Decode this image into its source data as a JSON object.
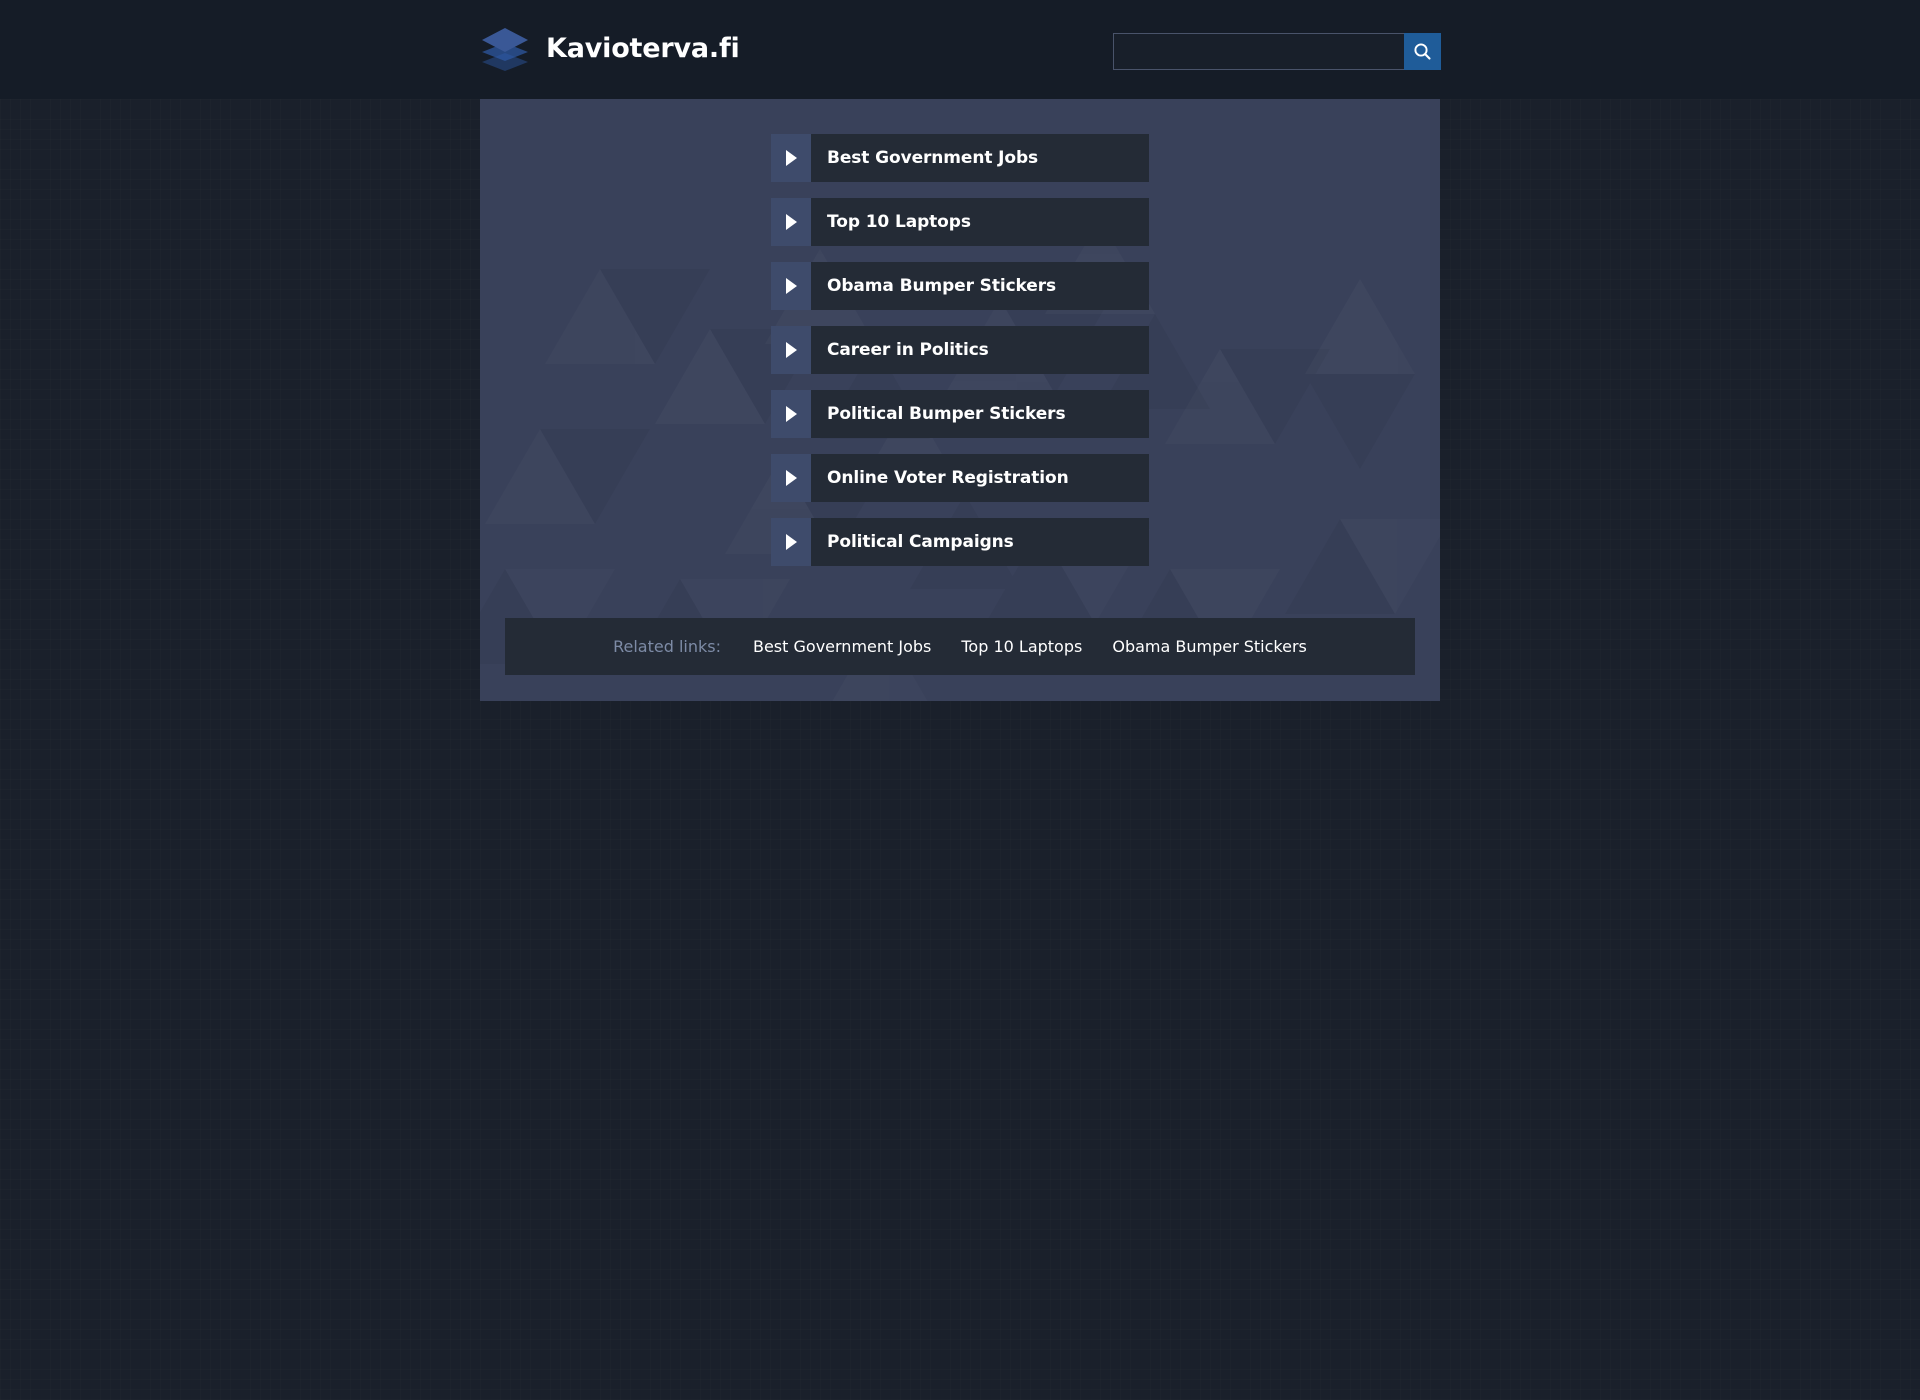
{
  "header": {
    "brand_name": "Kavioterva.fi",
    "logo_icon": "stacked-layers-icon",
    "search": {
      "value": "",
      "placeholder": "",
      "button_icon": "search-icon",
      "button_label": "Search"
    }
  },
  "main": {
    "items": [
      {
        "label": "Best Government Jobs",
        "icon": "play-triangle-icon"
      },
      {
        "label": "Top 10 Laptops",
        "icon": "play-triangle-icon"
      },
      {
        "label": "Obama Bumper Stickers",
        "icon": "play-triangle-icon"
      },
      {
        "label": "Career in Politics",
        "icon": "play-triangle-icon"
      },
      {
        "label": "Political Bumper Stickers",
        "icon": "play-triangle-icon"
      },
      {
        "label": "Online Voter Registration",
        "icon": "play-triangle-icon"
      },
      {
        "label": "Political Campaigns",
        "icon": "play-triangle-icon"
      }
    ]
  },
  "related": {
    "label": "Related links:",
    "links": [
      "Best Government Jobs",
      "Top 10 Laptops",
      "Obama Bumper Stickers"
    ]
  },
  "colors": {
    "header_bg": "#151c27",
    "page_bg": "#1a202b",
    "container_bg": "#39415a",
    "item_body_bg": "#242b36",
    "item_arrow_bg": "#3e4b6b",
    "accent_blue": "#1f5c99",
    "related_label": "#7d8ba6",
    "text_white": "#ffffff"
  }
}
